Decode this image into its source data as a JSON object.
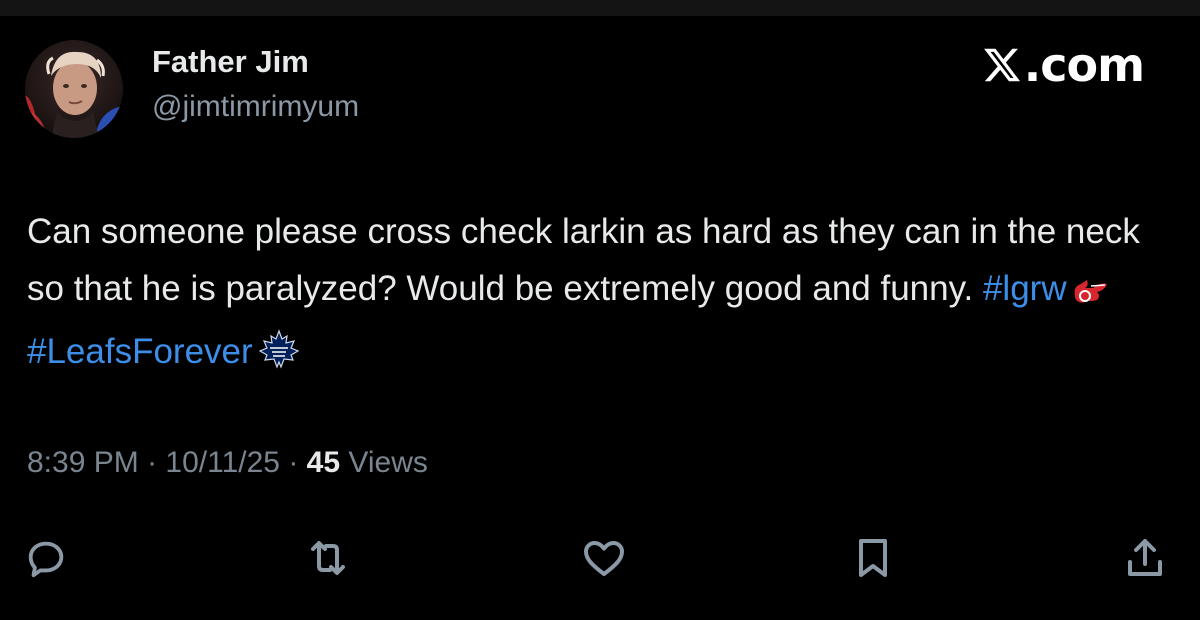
{
  "author": {
    "name": "Father Jim",
    "handle": "@jimtimrimyum"
  },
  "brand": {
    "label": ".com",
    "icon": "x-logo-icon"
  },
  "tweet": {
    "text_part1": "Can someone please cross check larkin as hard as they can in the neck so that he is paralyzed? Would be extremely good and funny.",
    "hashtag1": "#lgrw",
    "emoji1": "red-wings-logo-icon",
    "hashtag2": "#LeafsForever",
    "emoji2": "maple-leafs-logo-icon"
  },
  "meta": {
    "time": "8:39 PM",
    "separator": "·",
    "date": "10/11/25",
    "views_count": "45",
    "views_label": "Views"
  },
  "actions": {
    "reply_icon": "reply-icon",
    "repost_icon": "repost-icon",
    "like_icon": "heart-icon",
    "bookmark_icon": "bookmark-icon",
    "share_icon": "share-icon"
  },
  "colors": {
    "background": "#000000",
    "text": "#e7e9ea",
    "secondary": "#8b98a5",
    "hashtag": "#3d8ee8"
  }
}
